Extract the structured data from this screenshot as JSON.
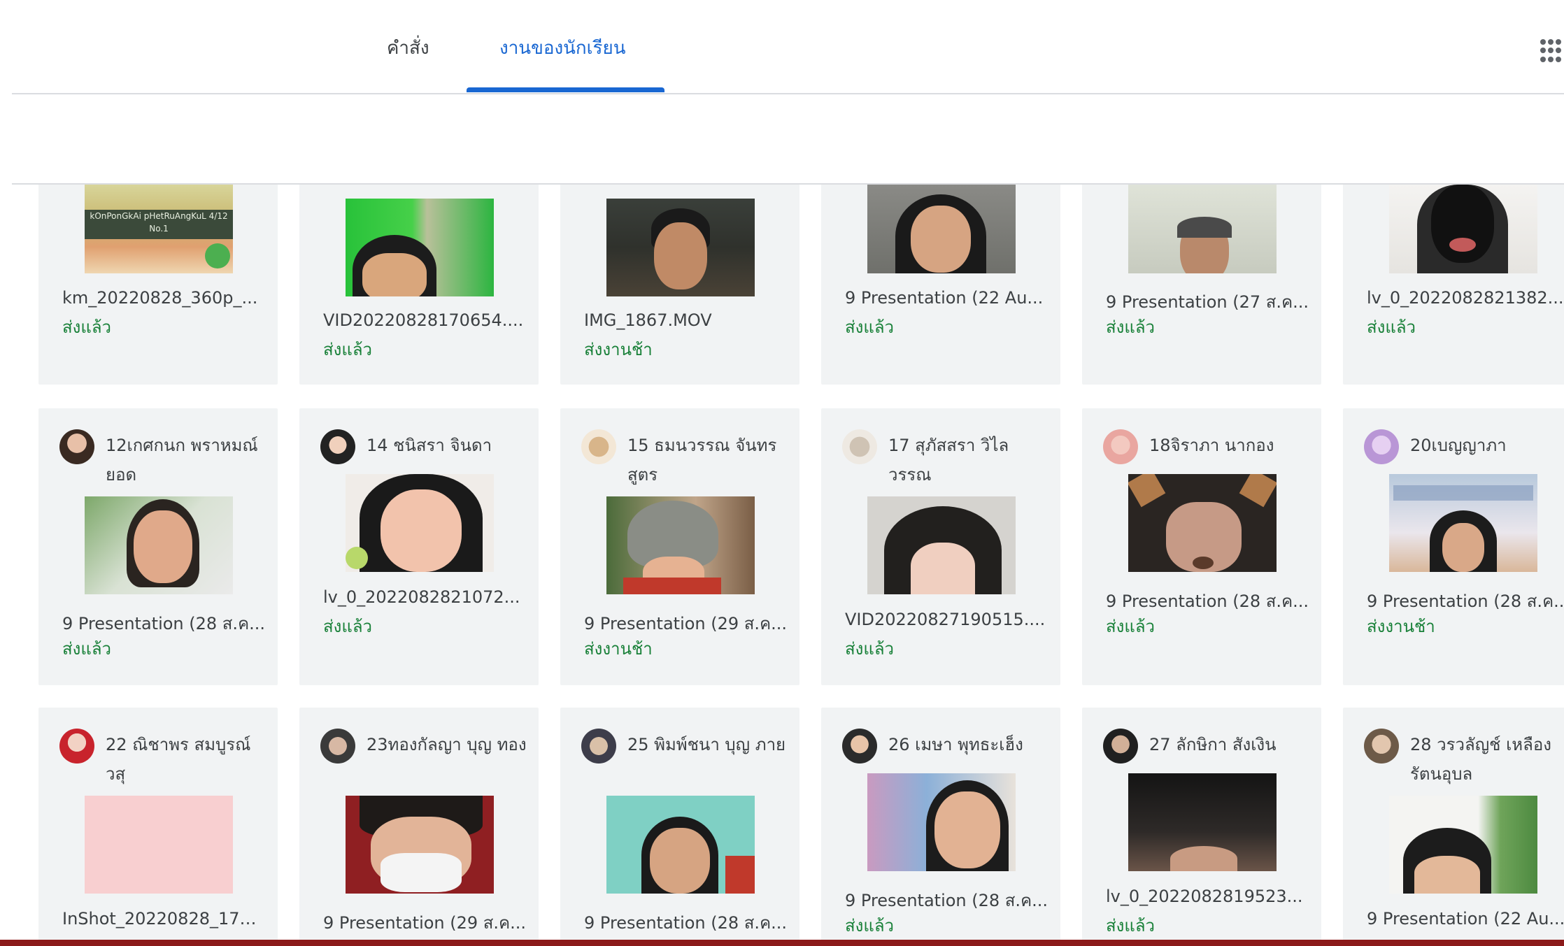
{
  "tabs": [
    {
      "label": "คำสั่ง"
    },
    {
      "label": "งานของนักเรียน"
    }
  ],
  "row1": [
    {
      "file": "km_20220828_360p_...",
      "status": "ส่งแล้ว",
      "overlay_text": "kOnPonGkAi pHetRuAngKuL 4/12 No.1"
    },
    {
      "file": "VID20220828170654....",
      "status": "ส่งแล้ว"
    },
    {
      "file": "IMG_1867.MOV",
      "status": "ส่งงานช้า"
    },
    {
      "file": "9 Presentation (22 Au...",
      "status": "ส่งแล้ว"
    },
    {
      "file": "9 Presentation (27 ส.ค...",
      "status": "ส่งแล้ว"
    },
    {
      "file": "lv_0_2022082821382...",
      "status": "ส่งแล้ว"
    }
  ],
  "row2": [
    {
      "name": "12เกศกนก พราหมณ์ยอด",
      "file": "9 Presentation (28 ส.ค...",
      "status": "ส่งแล้ว"
    },
    {
      "name": "14 ชนิสรา จินดา",
      "file": "lv_0_2022082821072...",
      "status": "ส่งแล้ว"
    },
    {
      "name": "15 ธมนวรรณ จันทร สูตร",
      "file": "9 Presentation (29 ส.ค...",
      "status": "ส่งงานช้า"
    },
    {
      "name": "17 สุภัสสรา วิไล วรรณ",
      "file": "VID20220827190515....",
      "status": "ส่งแล้ว"
    },
    {
      "name": "18จิราภา นากอง",
      "file": "9 Presentation (28 ส.ค...",
      "status": "ส่งแล้ว"
    },
    {
      "name": "20เบญญาภา",
      "file": "9 Presentation (28 ส.ค...",
      "status": "ส่งงานช้า"
    }
  ],
  "row3": [
    {
      "name": "22 ณิชาพร สมบูรณ์ วสุ",
      "file": "InShot_20220828_170..."
    },
    {
      "name": "23ทองกัลญา บุญ ทอง",
      "file": "9 Presentation (29 ส.ค..."
    },
    {
      "name": "25 พิมพ์ชนา บุญ ภาย",
      "file": "9 Presentation (28 ส.ค..."
    },
    {
      "name": "26 เมษา พุทธะเฮ็ง",
      "file": "9 Presentation (28 ส.ค...",
      "status": "ส่งแล้ว"
    },
    {
      "name": "27 ลักษิกา สังเงิน",
      "file": "lv_0_2022082819523...",
      "status": "ส่งแล้ว"
    },
    {
      "name": "28 วรวลัญช์ เหลือง รัตนอุบล",
      "file": "9 Presentation (22 Au..."
    }
  ]
}
